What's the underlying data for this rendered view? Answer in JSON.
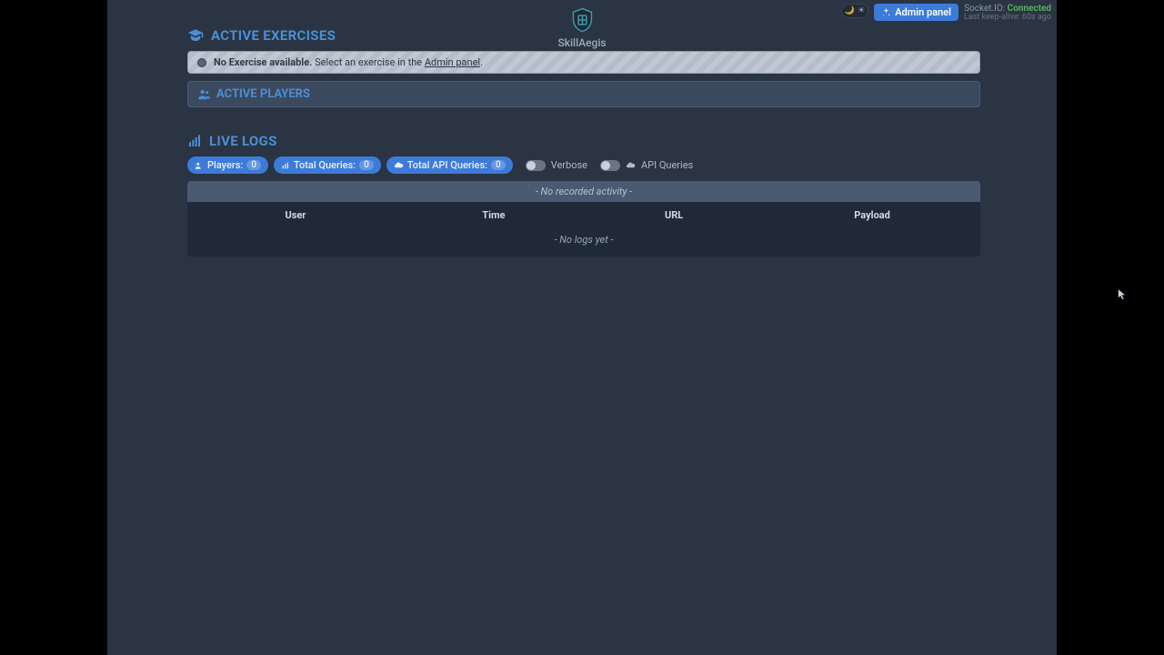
{
  "brand": {
    "name": "SkillAegis"
  },
  "topbar": {
    "admin_label": "Admin panel",
    "socket_label": "Socket.IO:",
    "socket_status": "Connected",
    "keepalive": "Last keep-alive: 60s ago"
  },
  "exercises": {
    "title": "ACTIVE EXERCISES",
    "notice_strong": "No Exercise available.",
    "notice_text": "Select an exercise in the ",
    "notice_link": "Admin panel",
    "notice_period": "."
  },
  "players": {
    "title": "ACTIVE PLAYERS"
  },
  "livelogs": {
    "title": "LIVE LOGS",
    "pills": {
      "players_label": "Players:",
      "players_value": "0",
      "queries_label": "Total Queries:",
      "queries_value": "0",
      "apiqueries_label": "Total API Queries:",
      "apiqueries_value": "0"
    },
    "toggles": {
      "verbose": "Verbose",
      "api": "API Queries"
    },
    "activity_placeholder": "- No recorded activity -",
    "headers": {
      "user": "User",
      "time": "Time",
      "url": "URL",
      "payload": "Payload"
    },
    "empty": "- No logs yet -"
  }
}
